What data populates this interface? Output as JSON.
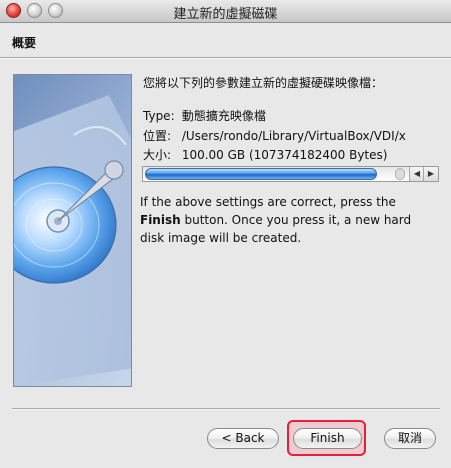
{
  "window": {
    "title": "建立新的虛擬磁碟"
  },
  "page": {
    "section_title": "概要",
    "heading": "您將以下列的參數建立新的虛擬硬碟映像檔："
  },
  "summary": {
    "type_label": "Type:",
    "type_value": "動態擴充映像檔",
    "location_label": "位置:",
    "location_value": "/Users/rondo/Library/VirtualBox/VDI/x",
    "size_label": "大小:",
    "size_value": "100.00 GB (107374182400 Bytes)"
  },
  "scrollbar": {
    "position_fraction": 0.78,
    "left_arrow": "◀",
    "right_arrow": "▶"
  },
  "description": {
    "line1": "If the above settings are correct, press the",
    "finish_word": "Finish",
    "line2_rest": " button. Once you press it, a new hard disk image will be created."
  },
  "buttons": {
    "back": "< Back",
    "finish": "Finish",
    "cancel": "取消"
  },
  "colors": {
    "highlight": "#e5203a",
    "accent": "#1d63c7"
  }
}
